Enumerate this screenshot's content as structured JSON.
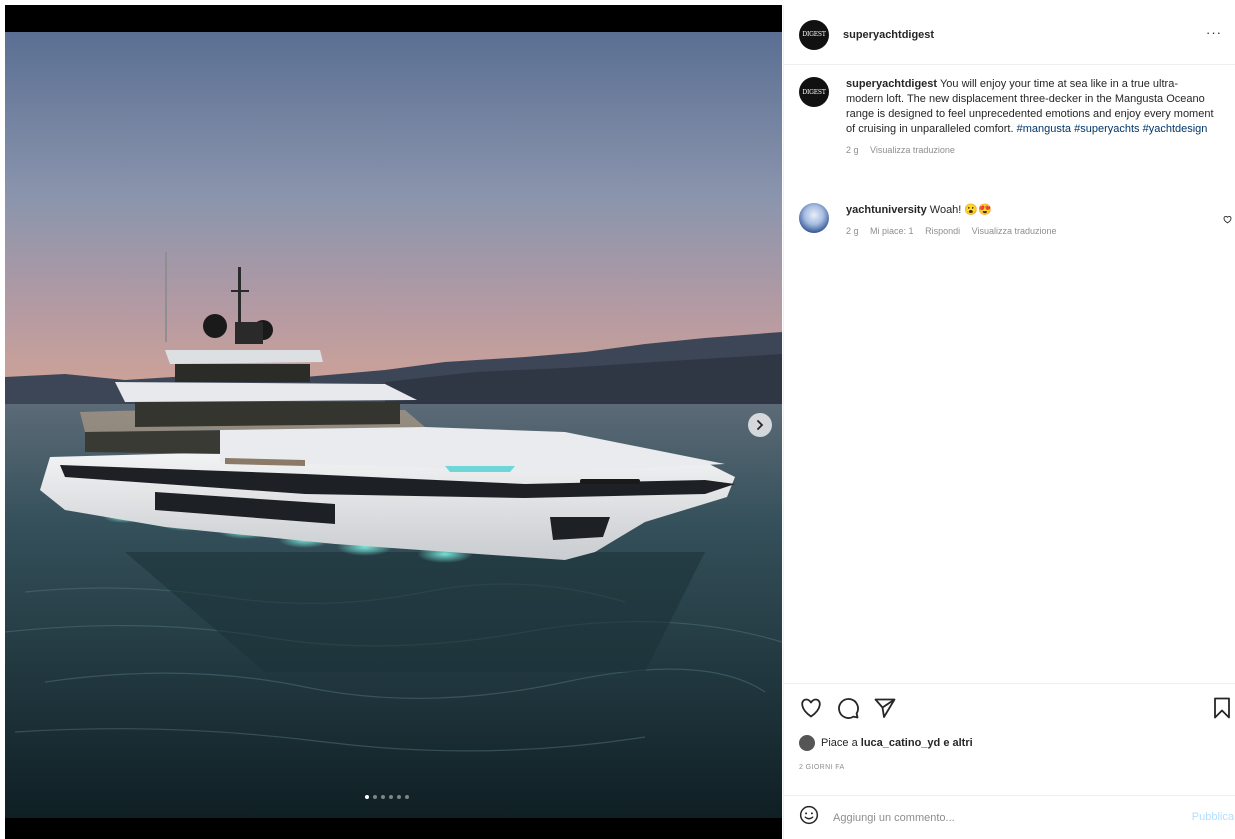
{
  "post": {
    "username": "superyachtdigest",
    "avatar_text": "DIGEST",
    "more_label": "···",
    "caption": {
      "username": "superyachtdigest",
      "text": "You will enjoy your time at sea like in a true ultra-modern loft. The new displacement three-decker in the Mangusta Oceano range is designed to feel unprecedented emotions and enjoy every moment of cruising in unparalleled comfort.",
      "hashtags": [
        "#mangusta",
        "#superyachts",
        "#yachtdesign"
      ],
      "time": "2 g",
      "translate": "Visualizza traduzione"
    },
    "comments": [
      {
        "username": "yachtuniversity",
        "text": "Woah! 😮😍",
        "time": "2 g",
        "likes": "Mi piace: 1",
        "reply": "Rispondi",
        "translate": "Visualizza traduzione"
      }
    ],
    "likes_prefix": "Piace a",
    "likes_user": "luca_catino_yd",
    "likes_suffix": "e altri",
    "date": "2 GIORNI FA",
    "add_comment_placeholder": "Aggiungi un commento...",
    "publish_label": "Pubblica"
  },
  "carousel": {
    "count": 6,
    "active_index": 0
  },
  "icons": {
    "next": "chevron-right-icon",
    "like": "heart-icon",
    "comment": "comment-icon",
    "share": "send-icon",
    "save": "bookmark-icon",
    "emoji": "emoji-icon"
  },
  "colors": {
    "link": "#00376b",
    "publish": "#b2dffc",
    "muted": "#8e8e8e",
    "text": "#262626"
  }
}
